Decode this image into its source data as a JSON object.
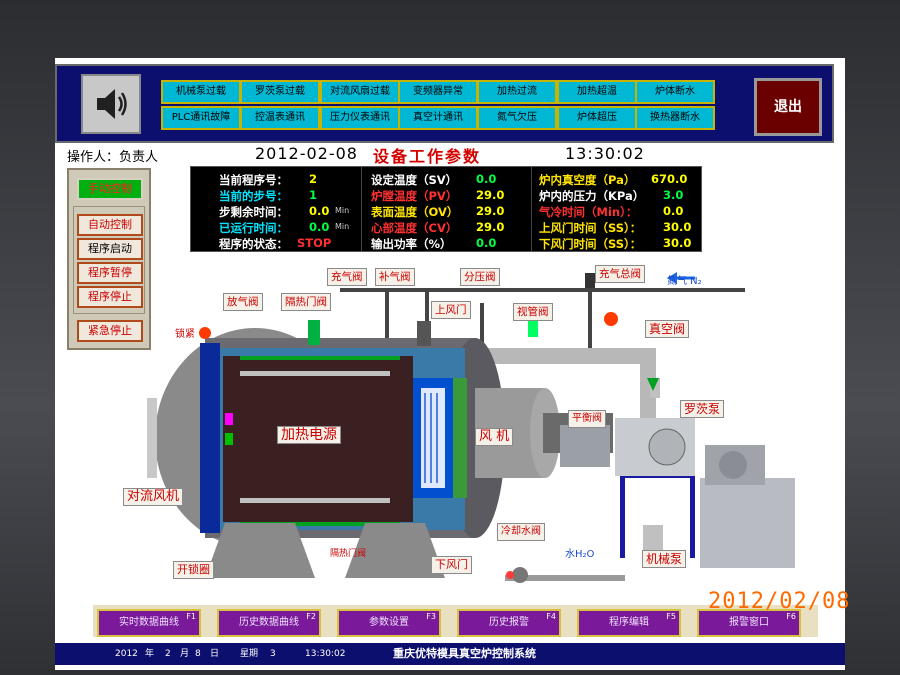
{
  "alarms_row1": [
    "机械泵过载",
    "罗茨泵过载",
    "对流风扇过载",
    "变频器异常",
    "加热过流",
    "加热超温",
    "炉体断水"
  ],
  "alarms_row2": [
    "PLC通讯故障",
    "控温表通讯",
    "压力仪表通讯",
    "真空计通讯",
    "氮气欠压",
    "炉体超压",
    "换热器断水"
  ],
  "exit_label": "退出",
  "operator": "操作人：负责人",
  "date": "2012-02-08",
  "panel_title": "设备工作参数",
  "time": "13:30:02",
  "controls": {
    "manual": "手动控制",
    "auto": "自动控制",
    "start": "程序启动",
    "pause": "程序暂停",
    "stop": "程序停止",
    "estop": "紧急停止"
  },
  "params": {
    "col1": [
      {
        "label": "当前程序号：",
        "value": "2",
        "unit": ""
      },
      {
        "label": "当前的步号：",
        "value": "1",
        "unit": ""
      },
      {
        "label": "步剩余时间：",
        "value": "0.0",
        "unit": "Min"
      },
      {
        "label": "已运行时间：",
        "value": "0.0",
        "unit": "Min"
      },
      {
        "label": "程序的状态：",
        "value": "STOP",
        "unit": ""
      }
    ],
    "col2": [
      {
        "label": "设定温度（SV）",
        "value": "0.0"
      },
      {
        "label": "炉膛温度（PV）",
        "value": "29.0"
      },
      {
        "label": "表面温度（OV）",
        "value": "29.0"
      },
      {
        "label": "心部温度（CV）",
        "value": "29.0"
      },
      {
        "label": "输出功率（%）",
        "value": "0.0"
      }
    ],
    "col3": [
      {
        "label": "炉内真空度（Pa）",
        "value": "670.0"
      },
      {
        "label": "炉内的压力（KPa）",
        "value": "3.0"
      },
      {
        "label": "气冷时间（Min）：",
        "value": "0.0"
      },
      {
        "label": "上风门时间（SS）：",
        "value": "30.0"
      },
      {
        "label": "下风门时间（SS）：",
        "value": "30.0"
      }
    ]
  },
  "diagram": {
    "chongqi": "充气阀",
    "buqi": "补气阀",
    "fenya": "分压阀",
    "chongqi_zong": "充气总阀",
    "nitrogen": "氮气 N₂",
    "fangqi": "放气阀",
    "gerefm": "隔热门阀",
    "shangfengmen": "上风门",
    "shiguan": "视管阀",
    "lock": "锁紧",
    "vacuum_valve": "真空阀",
    "heater": "加热电源",
    "fan": "风 机",
    "balance": "平衡阀",
    "roots": "罗茨泵",
    "convect_fan": "对流风机",
    "gerefm2": "隔热门阀",
    "cooling": "冷却水阀",
    "water": "水H₂O",
    "mech_pump": "机械泵",
    "xiafengmen": "下风门",
    "open_door": "开锁圈"
  },
  "fbuttons": [
    {
      "label": "实时数据曲线",
      "key": "F1"
    },
    {
      "label": "历史数据曲线",
      "key": "F2"
    },
    {
      "label": "参数设置",
      "key": "F3"
    },
    {
      "label": "历史报警",
      "key": "F4"
    },
    {
      "label": "程序编辑",
      "key": "F5"
    },
    {
      "label": "报警窗口",
      "key": "F6"
    }
  ],
  "status": {
    "year": "2012",
    "y": "年",
    "month": "2",
    "m": "月",
    "day": "8",
    "d": "日",
    "weekday_label": "星期",
    "weekday": "3",
    "time": "13:30:02",
    "system_title": "重庆优特模具真空炉控制系统"
  },
  "camera_stamp": "2012/02/08",
  "colors": {
    "top_bar": "#0d0f6e",
    "alarm": "#00b8d4",
    "exit": "#6a0000",
    "panel_bg": "#000000",
    "fkey": "#7a1a9a"
  }
}
